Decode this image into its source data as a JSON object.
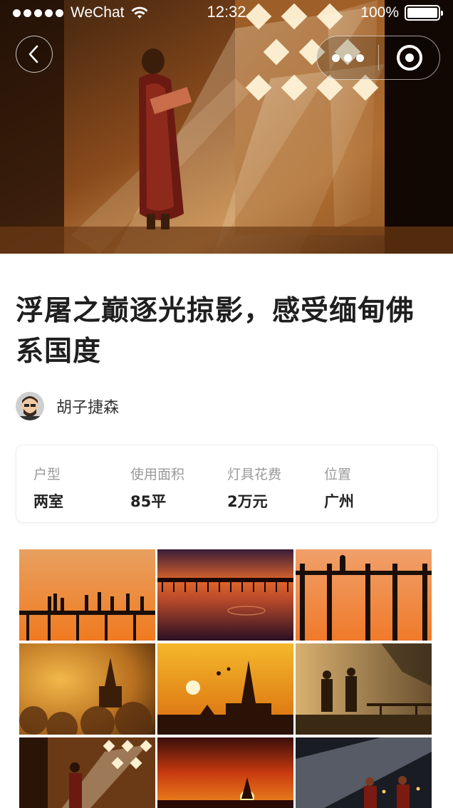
{
  "status_bar": {
    "carrier": "WeChat",
    "time": "12:32",
    "battery": "100%",
    "battery_level": 1.0
  },
  "nav": {
    "back_icon": "chevron-left-icon",
    "more_icon": "more-dots-icon",
    "close_icon": "target-circle-icon"
  },
  "article": {
    "title": "浮屠之巅逐光掠影，感受缅甸佛系国度",
    "author": "胡子捷森"
  },
  "info": [
    {
      "label": "户型",
      "value": "两室"
    },
    {
      "label": "使用面积",
      "value": "85平"
    },
    {
      "label": "灯具花费",
      "value": "2万元"
    },
    {
      "label": "位置",
      "value": "广州"
    }
  ],
  "colors": {
    "accent_orange": "#f08a2a",
    "title_text": "#1f1f1f",
    "label_gray": "#9a9a9a"
  }
}
